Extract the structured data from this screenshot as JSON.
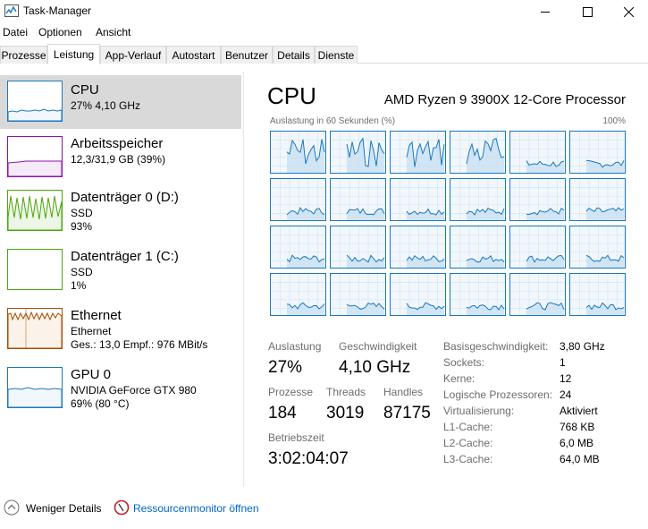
{
  "window": {
    "title": "Task-Manager"
  },
  "menu": [
    "Datei",
    "Optionen",
    "Ansicht"
  ],
  "tabs": [
    "Prozesse",
    "Leistung",
    "App-Verlauf",
    "Autostart",
    "Benutzer",
    "Details",
    "Dienste"
  ],
  "active_tab": "Leistung",
  "sidebar": {
    "items": [
      {
        "title": "CPU",
        "line1": "27% 4,10 GHz",
        "line2": "",
        "color": "#1b77bd"
      },
      {
        "title": "Arbeitsspeicher",
        "line1": "12,3/31,9 GB (39%)",
        "line2": "",
        "color": "#8b12ae"
      },
      {
        "title": "Datenträger 0 (D:)",
        "line1": "SSD",
        "line2": "93%",
        "color": "#4da60c"
      },
      {
        "title": "Datenträger 1 (C:)",
        "line1": "SSD",
        "line2": "1%",
        "color": "#4da60c"
      },
      {
        "title": "Ethernet",
        "line1": "Ethernet",
        "line2": "Ges.: 13,0  Empf.: 976 MBit/s",
        "color": "#a74f01"
      },
      {
        "title": "GPU 0",
        "line1": "NVIDIA GeForce GTX 980",
        "line2": "69% (80 °C)",
        "color": "#1b77bd"
      }
    ]
  },
  "main": {
    "title": "CPU",
    "model": "AMD Ryzen 9 3900X 12-Core Processor",
    "graph_caption": "Auslastung in 60 Sekunden (%)",
    "graph_max": "100%",
    "core_count": 24,
    "stats": {
      "utilization_label": "Auslastung",
      "utilization": "27%",
      "speed_label": "Geschwindigkeit",
      "speed": "4,10 GHz",
      "processes_label": "Prozesse",
      "processes": "184",
      "threads_label": "Threads",
      "threads": "3019",
      "handles_label": "Handles",
      "handles": "87175",
      "uptime_label": "Betriebszeit",
      "uptime": "3:02:04:07"
    },
    "info": [
      {
        "label": "Basisgeschwindigkeit:",
        "value": "3,80 GHz"
      },
      {
        "label": "Sockets:",
        "value": "1"
      },
      {
        "label": "Kerne:",
        "value": "12"
      },
      {
        "label": "Logische Prozessoren:",
        "value": "24"
      },
      {
        "label": "Virtualisierung:",
        "value": "Aktiviert"
      },
      {
        "label": "L1-Cache:",
        "value": "768 KB"
      },
      {
        "label": "L2-Cache:",
        "value": "6,0 MB"
      },
      {
        "label": "L3-Cache:",
        "value": "64,0 MB"
      }
    ]
  },
  "footer": {
    "fewer_details": "Weniger Details",
    "resource_monitor": "Ressourcenmonitor öffnen"
  },
  "colors": {
    "cpu": "#1b77bd",
    "memory": "#8b12ae",
    "disk": "#4da60c",
    "ethernet": "#a74f01",
    "selection": "#d9d9d9",
    "link": "#0066cc"
  }
}
